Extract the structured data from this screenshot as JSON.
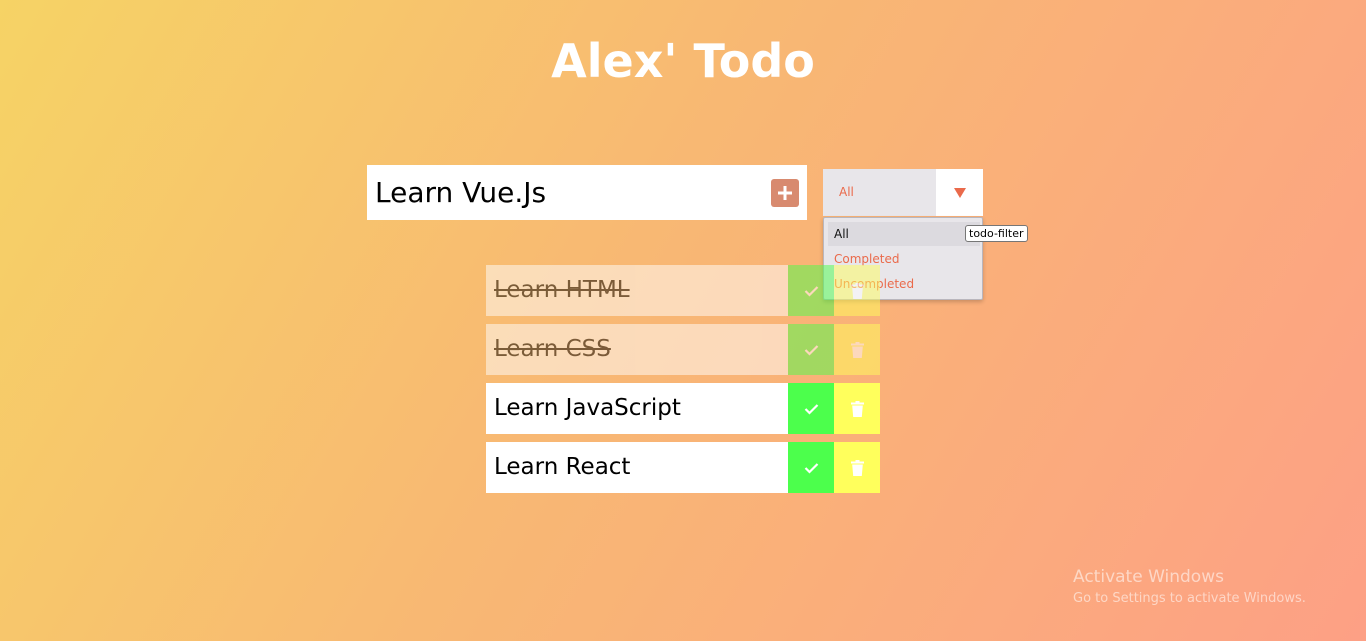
{
  "header": {
    "title": "Alex' Todo"
  },
  "form": {
    "input_value": "Learn Vue.Js"
  },
  "filter": {
    "selected": "All",
    "options": [
      "All",
      "Completed",
      "Uncompleted"
    ],
    "tooltip": "todo-filter"
  },
  "todos": [
    {
      "text": "Learn HTML",
      "completed": true
    },
    {
      "text": "Learn CSS",
      "completed": true
    },
    {
      "text": "Learn JavaScript",
      "completed": false
    },
    {
      "text": "Learn React",
      "completed": false
    }
  ],
  "watermark": {
    "line1": "Activate Windows",
    "line2": "Go to Settings to activate Windows."
  },
  "colors": {
    "complete": "#4cff4c",
    "trash": "#ffff5c",
    "accent": "#ea6a4b",
    "add_button": "#d88a6f"
  },
  "icons": {
    "add": "plus-icon",
    "complete": "check-icon",
    "trash": "trash-icon",
    "dropdown": "caret-down-icon"
  }
}
